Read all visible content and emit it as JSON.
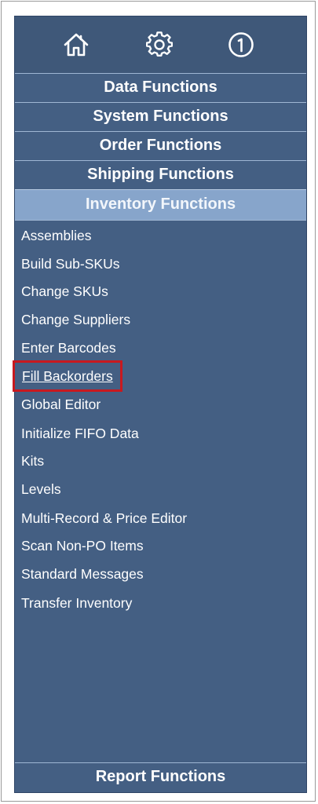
{
  "toolbar": {
    "icons": [
      "home-icon",
      "gear-icon",
      "info-icon"
    ]
  },
  "sections": {
    "data": "Data Functions",
    "system": "System Functions",
    "order": "Order Functions",
    "shipping": "Shipping Functions",
    "inventory": "Inventory Functions",
    "report": "Report Functions"
  },
  "inventory_items": [
    "Assemblies",
    "Build Sub-SKUs",
    "Change SKUs",
    "Change Suppliers",
    "Enter Barcodes",
    "Fill Backorders",
    "Global Editor",
    "Initialize FIFO Data",
    "Kits",
    "Levels",
    "Multi-Record & Price Editor",
    "Scan Non-PO Items",
    "Standard Messages",
    "Transfer Inventory"
  ],
  "colors": {
    "panel": "#445f83",
    "active_header": "#87a5cb",
    "highlight_box": "#c8191f",
    "text": "#ffffff"
  }
}
